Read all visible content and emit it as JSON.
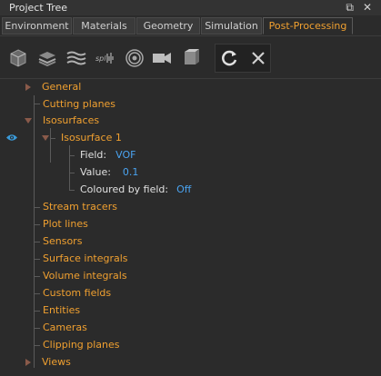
{
  "panel": {
    "title": "Project Tree",
    "restore_icon": "restore-window-icon",
    "close_icon": "close-icon"
  },
  "tabs": [
    {
      "label": "Environment",
      "active": false
    },
    {
      "label": "Materials",
      "active": false
    },
    {
      "label": "Geometry",
      "active": false
    },
    {
      "label": "Simulation",
      "active": false
    },
    {
      "label": "Post-Processing",
      "active": true
    }
  ],
  "toolbar": {
    "tools": [
      "cube-icon",
      "layers-icon",
      "streamlines-icon",
      "spline-icon",
      "rings-icon",
      "camera-icon",
      "box-icon"
    ],
    "refresh_icon": "refresh-icon",
    "clear_icon": "clear-icon"
  },
  "tree": {
    "general": "General",
    "cutting_planes": "Cutting planes",
    "isosurfaces": "Isosurfaces",
    "isosurface_1": "Isosurface 1",
    "field_label": "Field:",
    "field_value": "VOF",
    "value_label": "Value:",
    "value_value": "0.1",
    "coloured_label": "Coloured by field:",
    "coloured_value": "Off",
    "stream_tracers": "Stream tracers",
    "plot_lines": "Plot lines",
    "sensors": "Sensors",
    "surface_integrals": "Surface integrals",
    "volume_integrals": "Volume integrals",
    "custom_fields": "Custom fields",
    "entities": "Entities",
    "cameras": "Cameras",
    "clipping_planes": "Clipping planes",
    "views": "Views"
  },
  "colors": {
    "accent": "#f0a030",
    "value": "#4aa3f0",
    "eye": "#3a9ad9",
    "arrow": "#8a5a4a"
  }
}
